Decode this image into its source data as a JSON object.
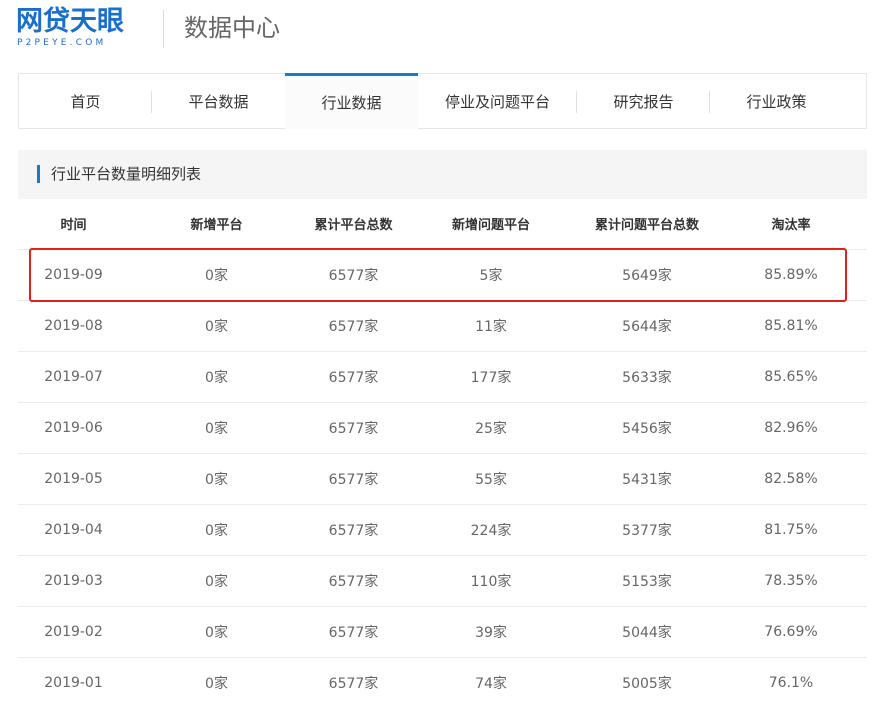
{
  "header": {
    "logo_cn": "网贷天眼",
    "logo_en": "P2PEYE.COM",
    "title": "数据中心"
  },
  "nav": {
    "tabs": [
      {
        "label": "首页"
      },
      {
        "label": "平台数据"
      },
      {
        "label": "行业数据",
        "active": true
      },
      {
        "label": "停业及问题平台"
      },
      {
        "label": "研究报告"
      },
      {
        "label": "行业政策"
      }
    ]
  },
  "panel": {
    "title": "行业平台数量明细列表"
  },
  "table": {
    "columns": [
      "时间",
      "新增平台",
      "累计平台总数",
      "新增问题平台",
      "累计问题平台总数",
      "淘汰率"
    ],
    "rows": [
      [
        "2019-09",
        "0家",
        "6577家",
        "5家",
        "5649家",
        "85.89%"
      ],
      [
        "2019-08",
        "0家",
        "6577家",
        "11家",
        "5644家",
        "85.81%"
      ],
      [
        "2019-07",
        "0家",
        "6577家",
        "177家",
        "5633家",
        "85.65%"
      ],
      [
        "2019-06",
        "0家",
        "6577家",
        "25家",
        "5456家",
        "82.96%"
      ],
      [
        "2019-05",
        "0家",
        "6577家",
        "55家",
        "5431家",
        "82.58%"
      ],
      [
        "2019-04",
        "0家",
        "6577家",
        "224家",
        "5377家",
        "81.75%"
      ],
      [
        "2019-03",
        "0家",
        "6577家",
        "110家",
        "5153家",
        "78.35%"
      ],
      [
        "2019-02",
        "0家",
        "6577家",
        "39家",
        "5044家",
        "76.69%"
      ],
      [
        "2019-01",
        "0家",
        "6577家",
        "74家",
        "5005家",
        "76.1%"
      ]
    ]
  },
  "colors": {
    "brand": "#1b6fc9",
    "accent": "#1b7ac7",
    "highlight": "#e02020"
  }
}
